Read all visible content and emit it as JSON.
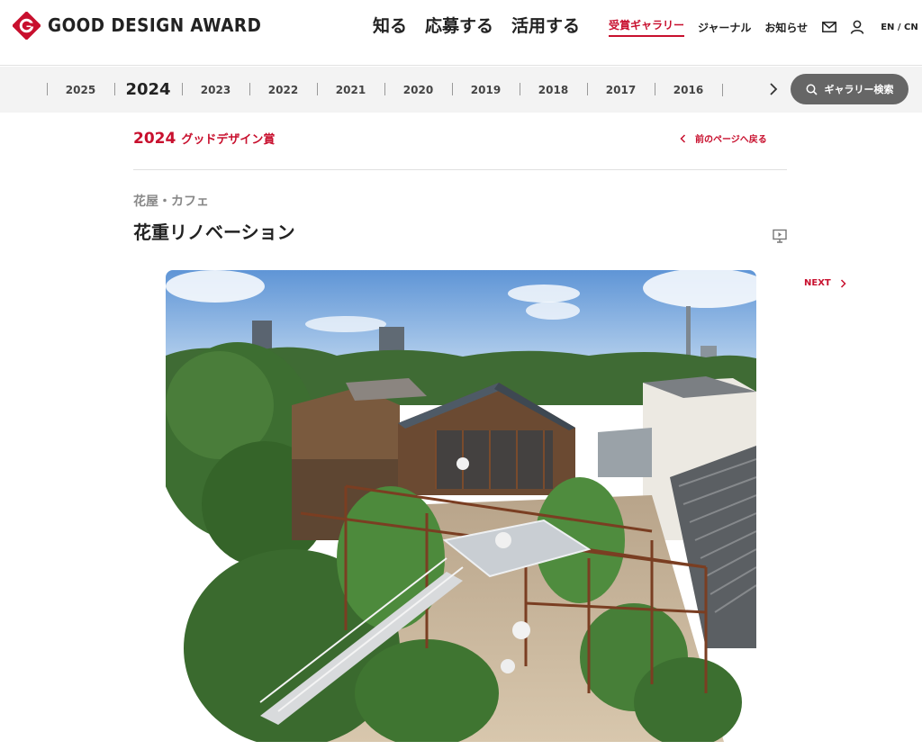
{
  "header": {
    "logo_text": "GOOD DESIGN AWARD",
    "main_nav": [
      "知る",
      "応募する",
      "活用する"
    ],
    "sub_nav": [
      "受賞ギャラリー",
      "ジャーナル",
      "お知らせ"
    ],
    "active_sub_nav": "受賞ギャラリー",
    "icons": [
      "mail-icon",
      "user-icon"
    ],
    "lang": "EN / CN"
  },
  "yearbar": {
    "years": [
      "2025",
      "2024",
      "2023",
      "2022",
      "2021",
      "2020",
      "2019",
      "2018",
      "2017",
      "2016"
    ],
    "current": "2024",
    "search_label": "ギャラリー検索"
  },
  "content": {
    "award_year": "2024",
    "award_name": "グッドデザイン賞",
    "back_label": "前のページへ戻る",
    "category": "花屋・カフェ",
    "title": "花重リノベーション",
    "next_label": "NEXT"
  },
  "colors": {
    "accent": "#c8102e",
    "search_button": "#666666",
    "yearbar_bg": "#f3f3f3"
  }
}
